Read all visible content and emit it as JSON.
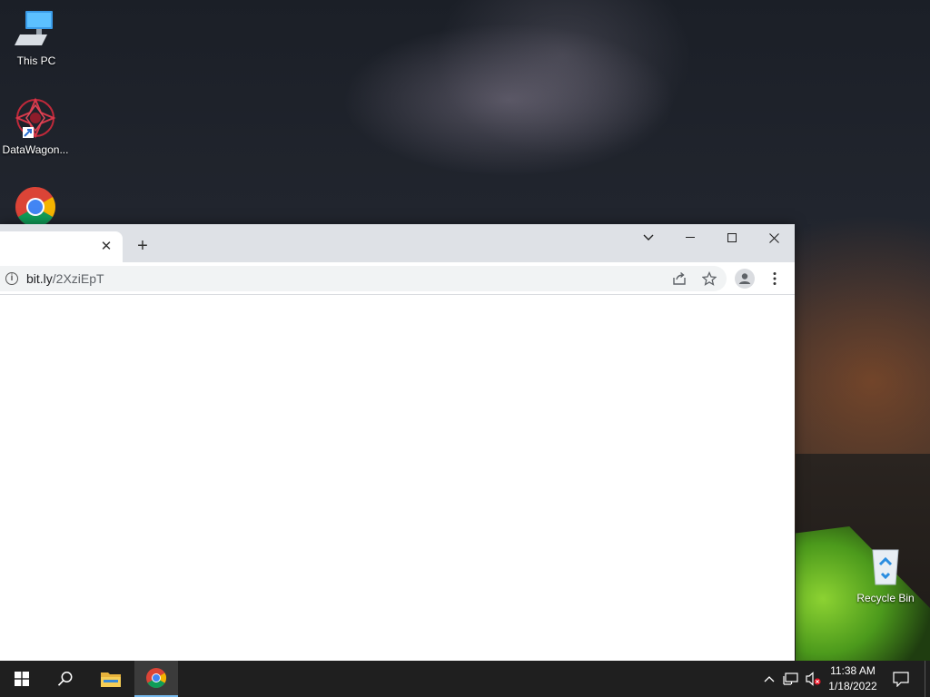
{
  "desktop": {
    "icons": [
      {
        "label": "This PC",
        "icon": "monitor-icon"
      },
      {
        "label": "DataWagon...",
        "icon": "datawagon-app-icon"
      },
      {
        "label": "",
        "icon": "chrome-icon"
      },
      {
        "label": "Recycle Bin",
        "icon": "recycle-bin-icon"
      }
    ]
  },
  "browser": {
    "tab": {
      "title": "",
      "close_glyph": "✕"
    },
    "new_tab_glyph": "+",
    "address": {
      "host": "bit.ly",
      "path": "/2XziEpT"
    },
    "window_controls": {
      "tab_search": "⌵",
      "minimize": "—",
      "maximize": "☐",
      "close": "✕"
    }
  },
  "taskbar": {
    "clock": {
      "time": "11:38 AM",
      "date": "1/18/2022"
    }
  },
  "colors": {
    "taskbar": "#1f1f1f",
    "tabstrip": "#dee1e6",
    "omnibox": "#f1f3f4",
    "active_indicator": "#76b9ed"
  }
}
